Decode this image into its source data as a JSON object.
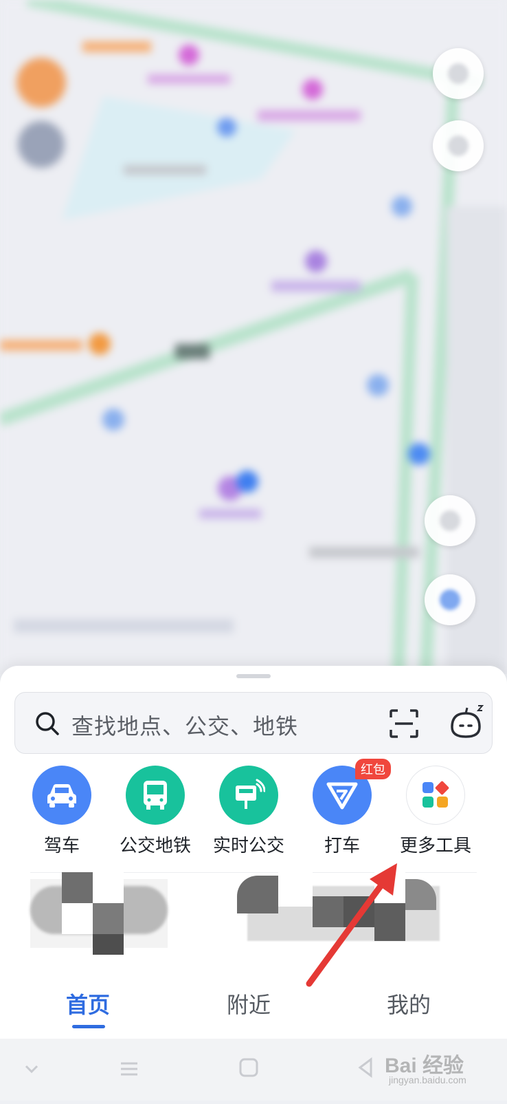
{
  "search": {
    "placeholder": "查找地点、公交、地铁"
  },
  "tools": [
    {
      "label": "驾车",
      "color": "#4a86f7",
      "icon": "car-icon"
    },
    {
      "label": "公交地铁",
      "color": "#18c29c",
      "icon": "bus-icon"
    },
    {
      "label": "实时公交",
      "color": "#18c29c",
      "icon": "bus-stop-icon"
    },
    {
      "label": "打车",
      "color": "#4a86f7",
      "icon": "taxi-icon",
      "badge": "红包"
    },
    {
      "label": "更多工具",
      "color": "#ffffff",
      "icon": "more-tools-icon"
    }
  ],
  "tabs": [
    {
      "label": "首页",
      "active": true
    },
    {
      "label": "附近",
      "active": false
    },
    {
      "label": "我的",
      "active": false
    }
  ],
  "watermark": {
    "main": "Bai 经验",
    "sub": "jingyan.baidu.com"
  },
  "colors": {
    "accent": "#2f6ce0",
    "badge": "#f0473d",
    "annotation_arrow": "#e53935"
  }
}
